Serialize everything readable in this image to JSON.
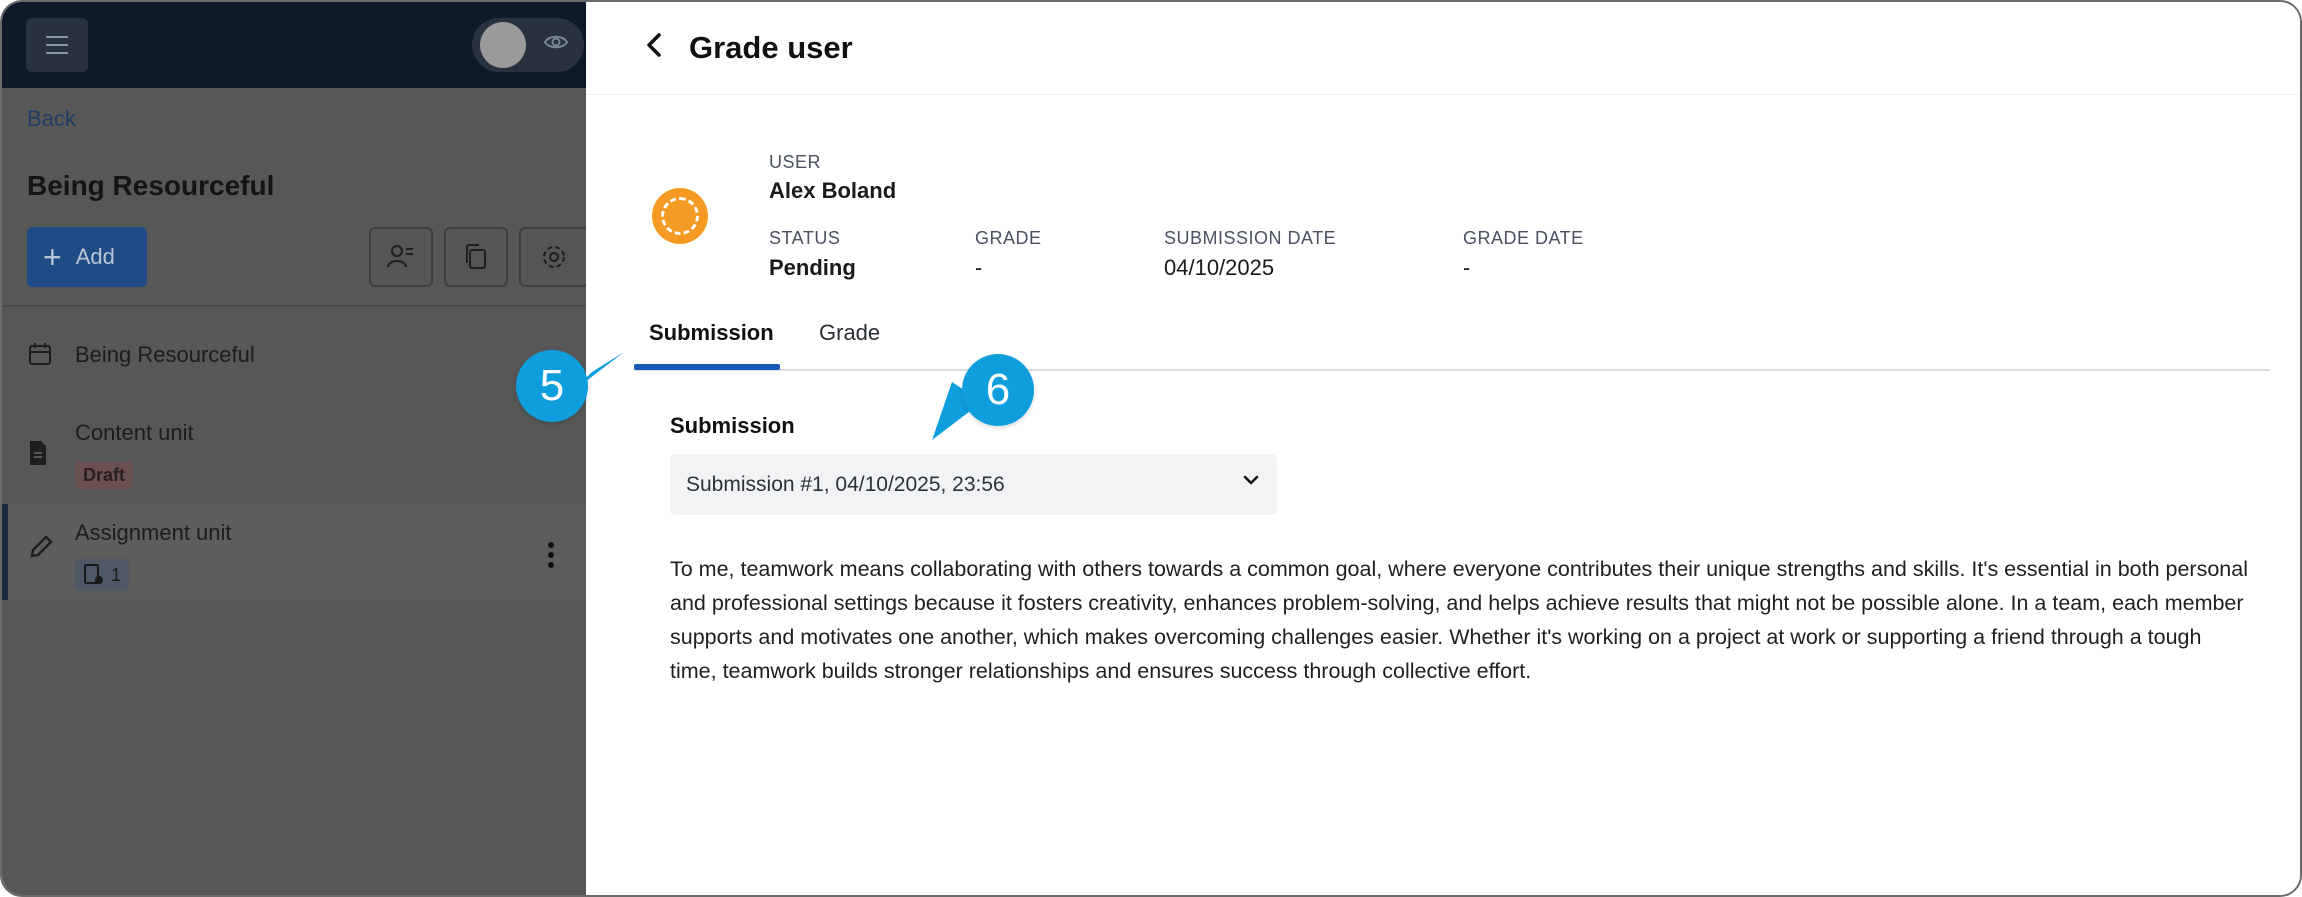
{
  "left": {
    "back_label": "Back",
    "course_title": "Being Resourceful",
    "add_label": "Add",
    "tree": [
      {
        "label": "Being Resourceful"
      },
      {
        "label": "Content unit",
        "badge": "Draft"
      },
      {
        "label": "Assignment unit",
        "count": "1"
      }
    ]
  },
  "panel": {
    "title": "Grade user",
    "user_label": "USER",
    "user_name": "Alex Boland",
    "status_label": "STATUS",
    "status_value": "Pending",
    "grade_label": "GRADE",
    "grade_value": "-",
    "submission_date_label": "SUBMISSION DATE",
    "submission_date_value": "04/10/2025",
    "grade_date_label": "GRADE DATE",
    "grade_date_value": "-",
    "tabs": [
      {
        "label": "Submission",
        "active": true
      },
      {
        "label": "Grade",
        "active": false
      }
    ],
    "section_title": "Submission",
    "selected_submission": "Submission #1, 04/10/2025, 23:56",
    "submission_text": "To me, teamwork means collaborating with others towards a common goal, where everyone contributes their unique strengths and skills. It's essential in both personal and professional settings because it fosters creativity, enhances problem-solving, and helps achieve results that might not be possible alone. In a team, each member supports and motivates one another, which makes overcoming challenges easier. Whether it's working on a project at work or supporting a friend through a tough time, teamwork builds stronger relationships and ensures success through collective effort."
  },
  "callouts": [
    "5",
    "6"
  ],
  "colors": {
    "accent": "#1b5cb8",
    "callout": "#0e9ede",
    "avatar": "#f59a23"
  }
}
